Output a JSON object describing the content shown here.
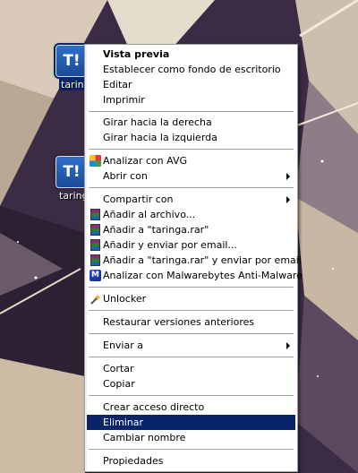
{
  "desktop": {
    "icons": [
      {
        "glyph": "T!",
        "label": "taring"
      },
      {
        "glyph": "T!",
        "label": "taring"
      }
    ]
  },
  "menu": {
    "items": [
      {
        "label": "Vista previa",
        "bold": true
      },
      {
        "label": "Establecer como fondo de escritorio"
      },
      {
        "label": "Editar"
      },
      {
        "label": "Imprimir"
      },
      {
        "label": "Girar hacia la derecha"
      },
      {
        "label": "Girar hacia la izquierda"
      },
      {
        "label": "Analizar con AVG",
        "icon": "avg-icon"
      },
      {
        "label": "Abrir con",
        "submenu": true
      },
      {
        "label": "Compartir con",
        "submenu": true
      },
      {
        "label": "Añadir al archivo...",
        "icon": "winrar-icon"
      },
      {
        "label": "Añadir a \"taringa.rar\"",
        "icon": "winrar-icon"
      },
      {
        "label": "Añadir y enviar por email...",
        "icon": "winrar-icon"
      },
      {
        "label": "Añadir a \"taringa.rar\" y enviar por email",
        "icon": "winrar-icon"
      },
      {
        "label": "Analizar con Malwarebytes Anti-Malware",
        "icon": "malwarebytes-icon"
      },
      {
        "label": "Unlocker",
        "icon": "unlocker-wand-icon"
      },
      {
        "label": "Restaurar versiones anteriores"
      },
      {
        "label": "Enviar a",
        "submenu": true
      },
      {
        "label": "Cortar"
      },
      {
        "label": "Copiar"
      },
      {
        "label": "Crear acceso directo"
      },
      {
        "label": "Eliminar",
        "highlighted": true
      },
      {
        "label": "Cambiar nombre"
      },
      {
        "label": "Propiedades"
      }
    ]
  },
  "colors": {
    "highlight": "#0a246a",
    "menu_bg": "#ffffff",
    "icon_tile": "#1a4b98"
  }
}
